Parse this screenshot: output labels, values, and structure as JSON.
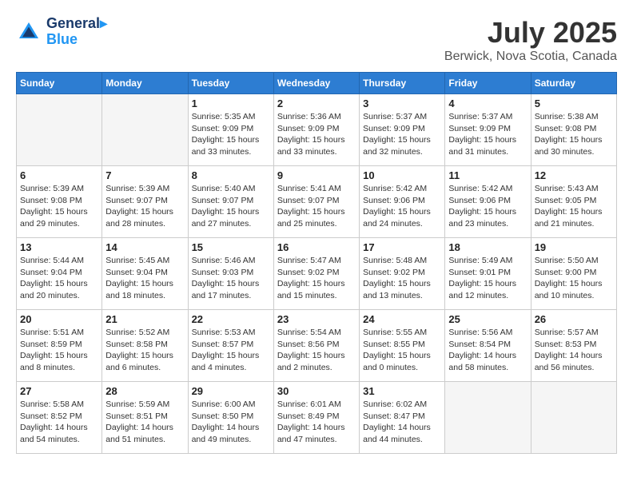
{
  "header": {
    "logo_line1": "General",
    "logo_line2": "Blue",
    "month_title": "July 2025",
    "location": "Berwick, Nova Scotia, Canada"
  },
  "days_of_week": [
    "Sunday",
    "Monday",
    "Tuesday",
    "Wednesday",
    "Thursday",
    "Friday",
    "Saturday"
  ],
  "weeks": [
    [
      {
        "day": "",
        "info": ""
      },
      {
        "day": "",
        "info": ""
      },
      {
        "day": "1",
        "info": "Sunrise: 5:35 AM\nSunset: 9:09 PM\nDaylight: 15 hours\nand 33 minutes."
      },
      {
        "day": "2",
        "info": "Sunrise: 5:36 AM\nSunset: 9:09 PM\nDaylight: 15 hours\nand 33 minutes."
      },
      {
        "day": "3",
        "info": "Sunrise: 5:37 AM\nSunset: 9:09 PM\nDaylight: 15 hours\nand 32 minutes."
      },
      {
        "day": "4",
        "info": "Sunrise: 5:37 AM\nSunset: 9:09 PM\nDaylight: 15 hours\nand 31 minutes."
      },
      {
        "day": "5",
        "info": "Sunrise: 5:38 AM\nSunset: 9:08 PM\nDaylight: 15 hours\nand 30 minutes."
      }
    ],
    [
      {
        "day": "6",
        "info": "Sunrise: 5:39 AM\nSunset: 9:08 PM\nDaylight: 15 hours\nand 29 minutes."
      },
      {
        "day": "7",
        "info": "Sunrise: 5:39 AM\nSunset: 9:07 PM\nDaylight: 15 hours\nand 28 minutes."
      },
      {
        "day": "8",
        "info": "Sunrise: 5:40 AM\nSunset: 9:07 PM\nDaylight: 15 hours\nand 27 minutes."
      },
      {
        "day": "9",
        "info": "Sunrise: 5:41 AM\nSunset: 9:07 PM\nDaylight: 15 hours\nand 25 minutes."
      },
      {
        "day": "10",
        "info": "Sunrise: 5:42 AM\nSunset: 9:06 PM\nDaylight: 15 hours\nand 24 minutes."
      },
      {
        "day": "11",
        "info": "Sunrise: 5:42 AM\nSunset: 9:06 PM\nDaylight: 15 hours\nand 23 minutes."
      },
      {
        "day": "12",
        "info": "Sunrise: 5:43 AM\nSunset: 9:05 PM\nDaylight: 15 hours\nand 21 minutes."
      }
    ],
    [
      {
        "day": "13",
        "info": "Sunrise: 5:44 AM\nSunset: 9:04 PM\nDaylight: 15 hours\nand 20 minutes."
      },
      {
        "day": "14",
        "info": "Sunrise: 5:45 AM\nSunset: 9:04 PM\nDaylight: 15 hours\nand 18 minutes."
      },
      {
        "day": "15",
        "info": "Sunrise: 5:46 AM\nSunset: 9:03 PM\nDaylight: 15 hours\nand 17 minutes."
      },
      {
        "day": "16",
        "info": "Sunrise: 5:47 AM\nSunset: 9:02 PM\nDaylight: 15 hours\nand 15 minutes."
      },
      {
        "day": "17",
        "info": "Sunrise: 5:48 AM\nSunset: 9:02 PM\nDaylight: 15 hours\nand 13 minutes."
      },
      {
        "day": "18",
        "info": "Sunrise: 5:49 AM\nSunset: 9:01 PM\nDaylight: 15 hours\nand 12 minutes."
      },
      {
        "day": "19",
        "info": "Sunrise: 5:50 AM\nSunset: 9:00 PM\nDaylight: 15 hours\nand 10 minutes."
      }
    ],
    [
      {
        "day": "20",
        "info": "Sunrise: 5:51 AM\nSunset: 8:59 PM\nDaylight: 15 hours\nand 8 minutes."
      },
      {
        "day": "21",
        "info": "Sunrise: 5:52 AM\nSunset: 8:58 PM\nDaylight: 15 hours\nand 6 minutes."
      },
      {
        "day": "22",
        "info": "Sunrise: 5:53 AM\nSunset: 8:57 PM\nDaylight: 15 hours\nand 4 minutes."
      },
      {
        "day": "23",
        "info": "Sunrise: 5:54 AM\nSunset: 8:56 PM\nDaylight: 15 hours\nand 2 minutes."
      },
      {
        "day": "24",
        "info": "Sunrise: 5:55 AM\nSunset: 8:55 PM\nDaylight: 15 hours\nand 0 minutes."
      },
      {
        "day": "25",
        "info": "Sunrise: 5:56 AM\nSunset: 8:54 PM\nDaylight: 14 hours\nand 58 minutes."
      },
      {
        "day": "26",
        "info": "Sunrise: 5:57 AM\nSunset: 8:53 PM\nDaylight: 14 hours\nand 56 minutes."
      }
    ],
    [
      {
        "day": "27",
        "info": "Sunrise: 5:58 AM\nSunset: 8:52 PM\nDaylight: 14 hours\nand 54 minutes."
      },
      {
        "day": "28",
        "info": "Sunrise: 5:59 AM\nSunset: 8:51 PM\nDaylight: 14 hours\nand 51 minutes."
      },
      {
        "day": "29",
        "info": "Sunrise: 6:00 AM\nSunset: 8:50 PM\nDaylight: 14 hours\nand 49 minutes."
      },
      {
        "day": "30",
        "info": "Sunrise: 6:01 AM\nSunset: 8:49 PM\nDaylight: 14 hours\nand 47 minutes."
      },
      {
        "day": "31",
        "info": "Sunrise: 6:02 AM\nSunset: 8:47 PM\nDaylight: 14 hours\nand 44 minutes."
      },
      {
        "day": "",
        "info": ""
      },
      {
        "day": "",
        "info": ""
      }
    ]
  ]
}
